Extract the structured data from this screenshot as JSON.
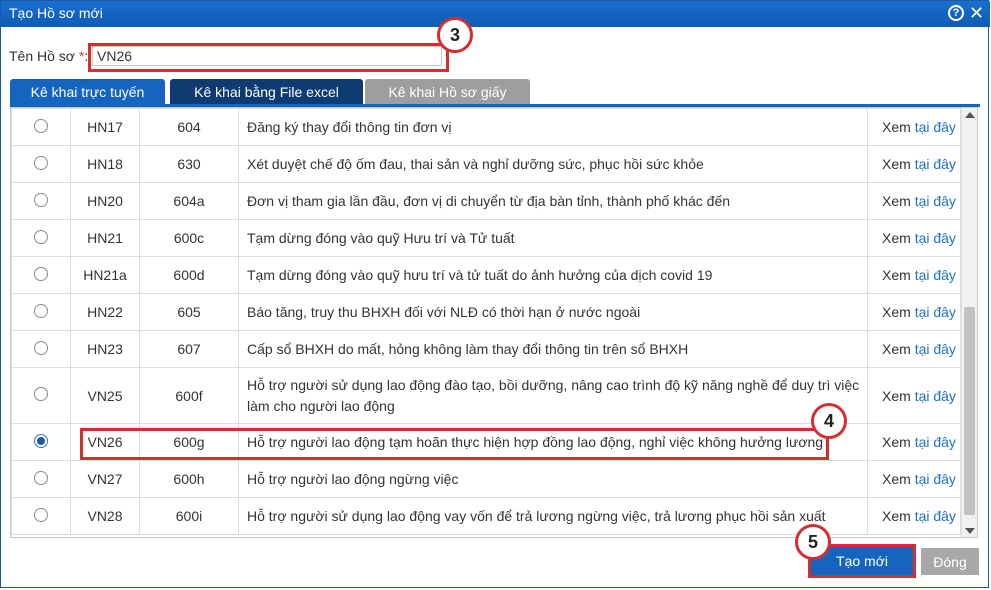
{
  "window": {
    "title": "Tạo Hồ sơ mới",
    "help_icon": "?",
    "close_icon": "✕"
  },
  "form": {
    "name_label": "Tên Hồ sơ",
    "required_mark": "*",
    "colon": ":",
    "name_value": "VN26"
  },
  "tabs": [
    {
      "label": "Kê khai trực tuyến",
      "active": true
    },
    {
      "label": "Kê khai bằng File excel",
      "active": false
    },
    {
      "label": "Kê khai Hồ sơ giấy",
      "active": false
    }
  ],
  "rows": [
    {
      "code": "HN17",
      "form": "604",
      "desc": "Đăng ký thay đổi thông tin đơn vị",
      "link_prefix": "Xem",
      "link_text": "tại đây",
      "selected": false
    },
    {
      "code": "HN18",
      "form": "630",
      "desc": "Xét duyệt chế độ ốm đau, thai sản và nghỉ dưỡng sức, phục hồi sức khỏe",
      "link_prefix": "Xem",
      "link_text": "tại đây",
      "selected": false
    },
    {
      "code": "HN20",
      "form": "604a",
      "desc": "Đơn vị tham gia lần đầu, đơn vị di chuyển từ địa bàn tỉnh, thành phố khác đến",
      "link_prefix": "Xem",
      "link_text": "tại đây",
      "selected": false
    },
    {
      "code": "HN21",
      "form": "600c",
      "desc": "Tạm dừng đóng vào quỹ Hưu trí và Tử tuất",
      "link_prefix": "Xem",
      "link_text": "tại đây",
      "selected": false
    },
    {
      "code": "HN21a",
      "form": "600d",
      "desc": "Tạm dừng đóng vào quỹ hưu trí và tử tuất do ảnh hưởng của dịch covid 19",
      "link_prefix": "Xem",
      "link_text": "tại đây",
      "selected": false
    },
    {
      "code": "HN22",
      "form": "605",
      "desc": "Báo tăng, truy thu BHXH đối với NLĐ có thời hạn ở nước ngoài",
      "link_prefix": "Xem",
      "link_text": "tại đây",
      "selected": false
    },
    {
      "code": "HN23",
      "form": "607",
      "desc": "Cấp sổ BHXH do mất, hỏng không làm thay đổi thông tin trên sổ BHXH",
      "link_prefix": "Xem",
      "link_text": "tại đây",
      "selected": false
    },
    {
      "code": "VN25",
      "form": "600f",
      "desc": "Hỗ trợ người sử dụng lao động đào tạo, bồi dưỡng, nâng cao trình độ kỹ năng nghề để duy trì việc làm cho người lao động",
      "link_prefix": "Xem",
      "link_text": "tại đây",
      "selected": false
    },
    {
      "code": "VN26",
      "form": "600g",
      "desc": "Hỗ trợ người lao động tạm hoãn thực hiện hợp đồng lao động, nghỉ việc không hưởng lương",
      "link_prefix": "Xem",
      "link_text": "tại đây",
      "selected": true
    },
    {
      "code": "VN27",
      "form": "600h",
      "desc": "Hỗ trợ người lao động ngừng việc",
      "link_prefix": "Xem",
      "link_text": "tại đây",
      "selected": false
    },
    {
      "code": "VN28",
      "form": "600i",
      "desc": "Hỗ trợ người sử dụng lao động vay vốn để trả lương ngừng việc, trả lương phục hồi sản xuất",
      "link_prefix": "Xem",
      "link_text": "tại đây",
      "selected": false
    }
  ],
  "callouts": {
    "c3": "3",
    "c4": "4",
    "c5": "5"
  },
  "buttons": {
    "create": "Tạo mới",
    "close": "Đóng"
  },
  "colors": {
    "titlebar": "#1565c0",
    "tab_active": "#1565c0",
    "tab_excel": "#0d3b72",
    "tab_disabled": "#9e9e9e",
    "highlight": "#d32f2f",
    "link": "#1e73c8"
  }
}
